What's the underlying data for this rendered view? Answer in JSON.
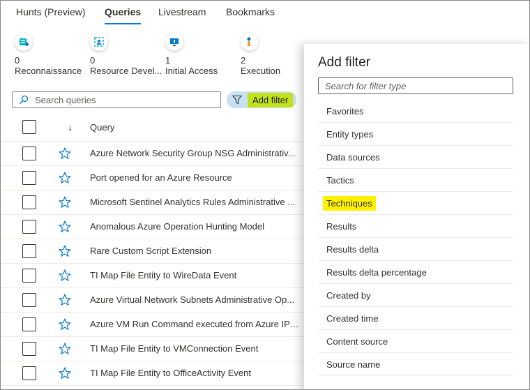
{
  "tabs": [
    {
      "label": "Hunts (Preview)",
      "active": false
    },
    {
      "label": "Queries",
      "active": true
    },
    {
      "label": "Livestream",
      "active": false
    },
    {
      "label": "Bookmarks",
      "active": false
    }
  ],
  "tactics": [
    {
      "count": "0",
      "name": "Reconnaissance",
      "icon": "reconnaissance-icon"
    },
    {
      "count": "0",
      "name": "Resource Devel...",
      "icon": "resource-development-icon"
    },
    {
      "count": "1",
      "name": "Initial Access",
      "icon": "initial-access-icon"
    },
    {
      "count": "2",
      "name": "Execution",
      "icon": "execution-icon"
    }
  ],
  "search": {
    "placeholder": "Search queries"
  },
  "add_filter": {
    "label": "Add filter",
    "highlight_color": "#c1e21b"
  },
  "table": {
    "sort_glyph": "↓",
    "column_query": "Query",
    "rows": [
      "Azure Network Security Group NSG Administrativ...",
      "Port opened for an Azure Resource",
      "Microsoft Sentinel Analytics Rules Administrative ...",
      "Anomalous Azure Operation Hunting Model",
      "Rare Custom Script Extension",
      "TI Map File Entity to WireData Event",
      "Azure Virtual Network Subnets Administrative Op...",
      "Azure VM Run Command executed from Azure IP ...",
      "TI Map File Entity to VMConnection Event",
      "TI Map File Entity to OfficeActivity Event"
    ]
  },
  "panel": {
    "title": "Add filter",
    "input_placeholder": "Search for filter type",
    "items": [
      "Favorites",
      "Entity types",
      "Data sources",
      "Tactics",
      "Techniques",
      "Results",
      "Results delta",
      "Results delta percentage",
      "Created by",
      "Created time",
      "Content source",
      "Source name"
    ],
    "highlighted_item": "Techniques",
    "highlight_color": "#fff200"
  },
  "colors": {
    "accent": "#0078d4",
    "star": "#0078d4"
  }
}
